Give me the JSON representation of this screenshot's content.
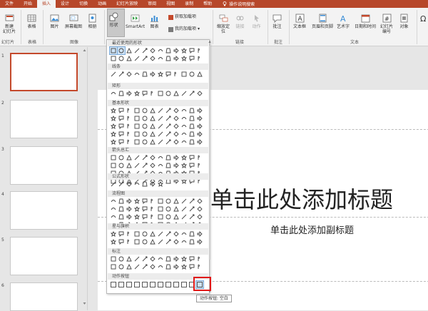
{
  "tabs": [
    "文件",
    "开始",
    "插入",
    "设计",
    "切换",
    "动画",
    "幻灯片放映",
    "审阅",
    "视图",
    "录制",
    "帮助",
    "操作说明搜索"
  ],
  "active_tab_index": 2,
  "ribbon": {
    "new_slide": "新建\n幻灯片",
    "group_slides": "幻灯片",
    "table": "表格",
    "group_table": "表格",
    "picture": "图片",
    "screenshot": "屏幕截图",
    "album": "相册",
    "group_images": "图像",
    "shapes": "形状",
    "smartart": "SmartArt",
    "chart": "图表",
    "get_addins": "获取加载项",
    "my_addins": "我的加载项",
    "zoom": "缩放定\n位",
    "link": "链接",
    "action": "动作",
    "group_links": "链接",
    "comment": "批注",
    "group_comments": "批注",
    "textbox": "文本框",
    "header_footer": "页眉和页脚",
    "wordart": "艺术字",
    "datetime": "日期和时间",
    "slide_number": "幻灯片\n编号",
    "object": "对象",
    "group_text": "文本"
  },
  "slide_numbers": [
    "1",
    "2",
    "3",
    "4",
    "5",
    "6"
  ],
  "slide": {
    "title_placeholder": "单击此处添加标题",
    "subtitle_placeholder": "单击此处添加副标题"
  },
  "shapes_menu": {
    "categories": [
      "最近使用的形状",
      "线条",
      "矩形",
      "基本形状",
      "箭头总汇",
      "公式形状",
      "流程图",
      "星与旗帜",
      "标注",
      "动作按钮"
    ]
  },
  "tooltip": "动作按钮: 空白",
  "colors": {
    "accent": "#b7472a",
    "highlight_box": "#e01818"
  }
}
